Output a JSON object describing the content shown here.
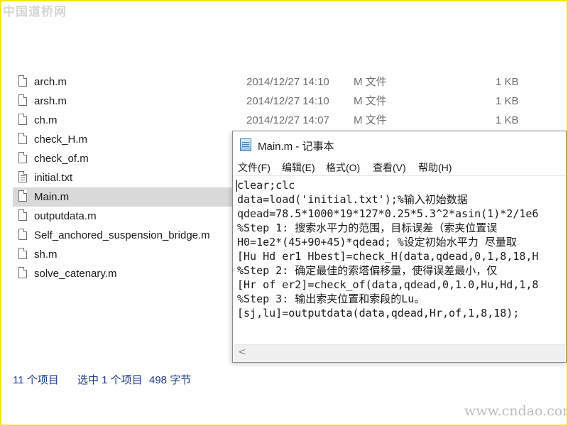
{
  "watermark": {
    "top_left": "中国道桥网",
    "bottom_right": "www.cndao.com"
  },
  "explorer": {
    "files": [
      {
        "name": "arch.m",
        "date": "2014/12/27 14:10",
        "type": "M 文件",
        "size": "1 KB",
        "icon": "m-file-icon"
      },
      {
        "name": "arsh.m",
        "date": "2014/12/27 14:10",
        "type": "M 文件",
        "size": "1 KB",
        "icon": "m-file-icon"
      },
      {
        "name": "ch.m",
        "date": "2014/12/27 14:07",
        "type": "M 文件",
        "size": "1 KB",
        "icon": "m-file-icon"
      },
      {
        "name": "check_H.m",
        "icon": "m-file-icon"
      },
      {
        "name": "check_of.m",
        "icon": "m-file-icon"
      },
      {
        "name": "initial.txt",
        "icon": "text-file-icon"
      },
      {
        "name": "Main.m",
        "icon": "m-file-icon",
        "selected": true
      },
      {
        "name": "outputdata.m",
        "icon": "m-file-icon"
      },
      {
        "name": "Self_anchored_suspension_bridge.m",
        "icon": "m-file-icon"
      },
      {
        "name": "sh.m",
        "icon": "m-file-icon"
      },
      {
        "name": "solve_catenary.m",
        "icon": "m-file-icon"
      }
    ]
  },
  "status_bar": {
    "item_count": "11 个项目",
    "selected": "选中 1 个项目",
    "size": "498 字节"
  },
  "notepad": {
    "title": "Main.m - 记事本",
    "menu": [
      "文件(F)",
      "编辑(E)",
      "格式(O)",
      "查看(V)",
      "帮助(H)"
    ],
    "lines": [
      "clear;clc",
      "data=load('initial.txt');%输入初始数据",
      "qdead=78.5*1000*19*127*0.25*5.3^2*asin(1)*2/1e6",
      "%Step 1: 搜索水平力的范围，目标误差（索夹位置误",
      "H0=1e2*(45+90+45)*qdead; %设定初始水平力 尽量取",
      "[Hu Hd er1 Hbest]=check_H(data,qdead,0,1,8,18,H",
      "%Step 2: 确定最佳的索塔偏移量，使得误差最小，仅",
      "[Hr of er2]=check_of(data,qdead,0,1.0,Hu,Hd,1,8",
      "%Step 3: 输出索夹位置和索段的Lu。",
      "[sj,lu]=outputdata(data,qdead,Hr,of,1,8,18);"
    ],
    "scroll_left_glyph": "<"
  }
}
